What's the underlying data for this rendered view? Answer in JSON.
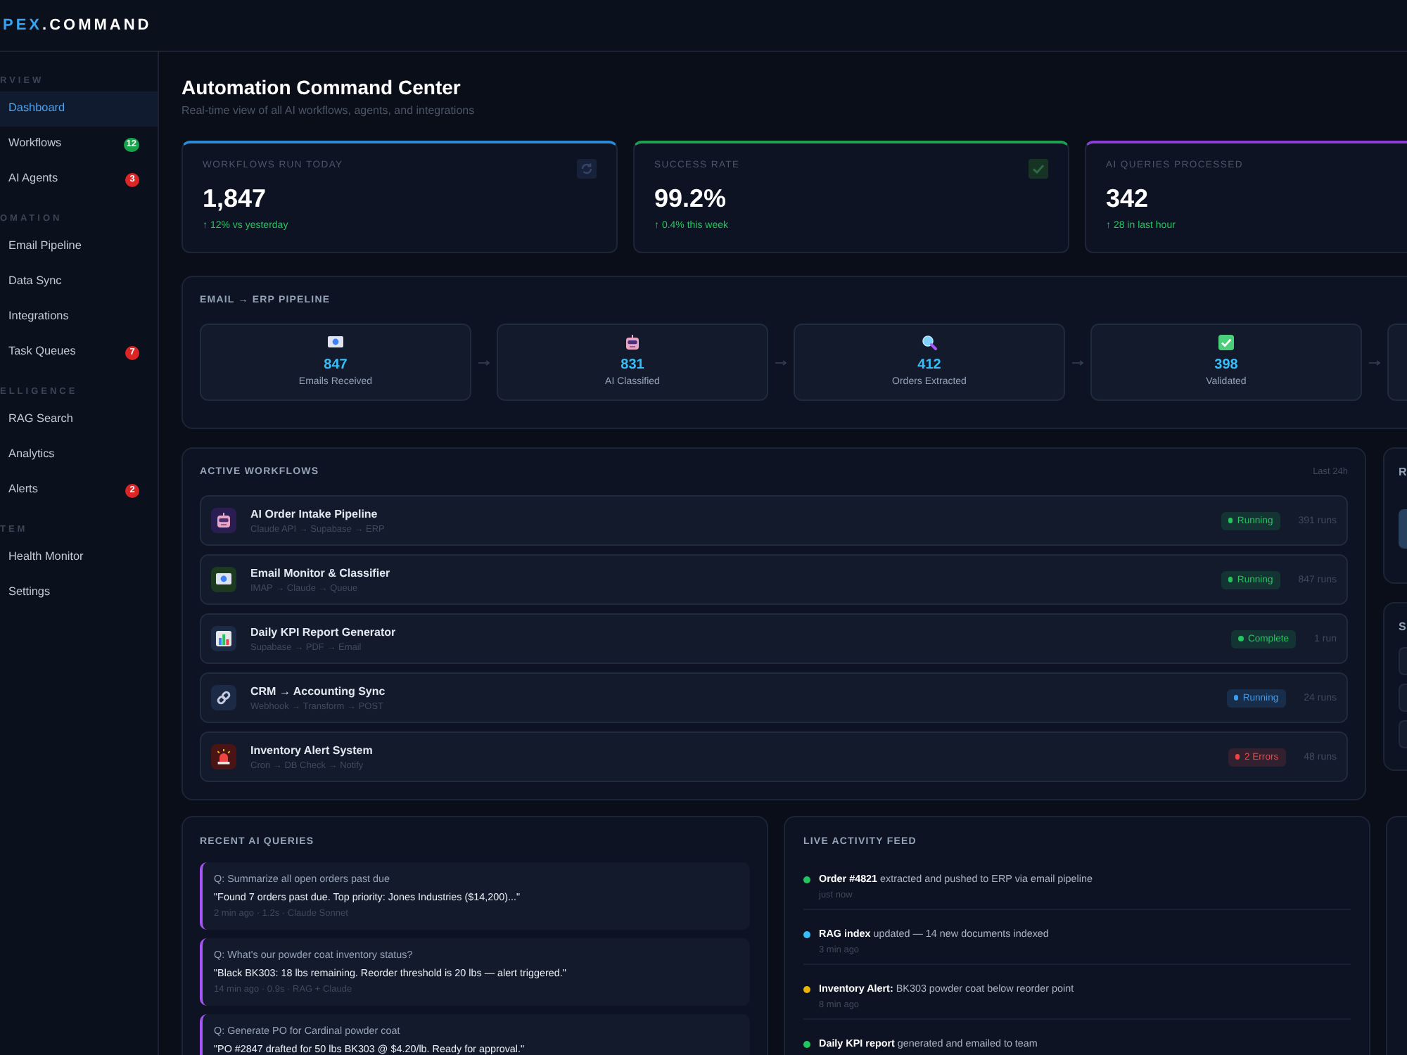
{
  "brand": {
    "accent": "PEX",
    "rest": ".COMMAND"
  },
  "sidebar": {
    "sections": [
      {
        "label": "RVIEW",
        "items": [
          {
            "label": "Dashboard",
            "selected": true
          },
          {
            "label": "Workflows",
            "selected": false,
            "badge": {
              "text": "12",
              "color": "#16a34a"
            }
          },
          {
            "label": "AI Agents",
            "selected": false,
            "badge": {
              "text": "3",
              "color": "#dc2626"
            }
          }
        ]
      },
      {
        "label": "OMATION",
        "items": [
          {
            "label": "Email Pipeline",
            "selected": false
          },
          {
            "label": "Data Sync",
            "selected": false
          },
          {
            "label": "Integrations",
            "selected": false
          },
          {
            "label": "Task Queues",
            "selected": false,
            "badge": {
              "text": "7",
              "color": "#dc2626"
            }
          }
        ]
      },
      {
        "label": "ELLIGENCE",
        "items": [
          {
            "label": "RAG Search",
            "selected": false
          },
          {
            "label": "Analytics",
            "selected": false
          },
          {
            "label": "Alerts",
            "selected": false,
            "badge": {
              "text": "2",
              "color": "#dc2626"
            }
          }
        ]
      },
      {
        "label": "TEM",
        "items": [
          {
            "label": "Health Monitor",
            "selected": false
          },
          {
            "label": "Settings",
            "selected": false
          }
        ]
      }
    ]
  },
  "header": {
    "title": "Automation Command Center",
    "subtitle": "Real-time view of all AI workflows, agents, and integrations"
  },
  "stats": [
    {
      "label": "WORKFLOWS RUN TODAY",
      "value": "1,847",
      "change": "↑ 12% vs yesterday",
      "color": "#2b8ad6"
    },
    {
      "label": "SUCCESS RATE",
      "value": "99.2%",
      "change": "↑ 0.4% this week",
      "color": "#1fa054"
    },
    {
      "label": "AI QUERIES PROCESSED",
      "value": "342",
      "change": "↑ 28 in last hour",
      "color": "#8b3fd6"
    }
  ],
  "pipeline": {
    "title": "EMAIL → ERP PIPELINE",
    "steps": [
      {
        "count": "847",
        "label": "Emails Received"
      },
      {
        "count": "831",
        "label": "AI Classified"
      },
      {
        "count": "412",
        "label": "Orders Extracted"
      },
      {
        "count": "398",
        "label": "Validated"
      }
    ]
  },
  "workflows": {
    "title": "ACTIVE WORKFLOWS",
    "period": "Last 24h",
    "items": [
      {
        "name": "AI Order Intake Pipeline",
        "route": "Claude API → Supabase → ERP",
        "status": {
          "text": "Running",
          "color": "#22c55e"
        },
        "runs": "391 runs"
      },
      {
        "name": "Email Monitor & Classifier",
        "route": "IMAP → Claude → Queue",
        "status": {
          "text": "Running",
          "color": "#22c55e"
        },
        "runs": "847 runs"
      },
      {
        "name": "Daily KPI Report Generator",
        "route": "Supabase → PDF → Email",
        "status": {
          "text": "Complete",
          "color": "#22c55e"
        },
        "runs": "1 run"
      },
      {
        "name": "CRM → Accounting Sync",
        "route": "Webhook → Transform → POST",
        "status": {
          "text": "Running",
          "color": "#3b9cf0"
        },
        "runs": "24 runs"
      },
      {
        "name": "Inventory Alert System",
        "route": "Cron → DB Check → Notify",
        "status": {
          "text": "2 Errors",
          "color": "#ef4444"
        },
        "runs": "48 runs"
      }
    ]
  },
  "side_panels": [
    {
      "title": "R"
    },
    {
      "title": "S"
    }
  ],
  "queries": {
    "title": "RECENT AI QUERIES",
    "items": [
      {
        "question": "Q: Summarize all open orders past due",
        "answer": "\"Found 7 orders past due. Top priority: Jones Industries ($14,200)...\"",
        "meta": "2 min ago · 1.2s · Claude Sonnet"
      },
      {
        "question": "Q: What's our powder coat inventory status?",
        "answer": "\"Black BK303: 18 lbs remaining. Reorder threshold is 20 lbs — alert triggered.\"",
        "meta": "14 min ago · 0.9s · RAG + Claude"
      },
      {
        "question": "Q: Generate PO for Cardinal powder coat",
        "answer": "\"PO #2847 drafted for 50 lbs BK303 @ $4.20/lb. Ready for approval.\""
      }
    ]
  },
  "activity": {
    "title": "LIVE ACTIVITY FEED",
    "items": [
      {
        "text": "**Order #4821** extracted and pushed to ERP via email pipeline",
        "time": "just now",
        "color": "#22c55e"
      },
      {
        "text": "**RAG index** updated — 14 new documents indexed",
        "time": "3 min ago",
        "color": "#38bdf8"
      },
      {
        "text": "**Inventory Alert:** BK303 powder coat below reorder point",
        "time": "8 min ago",
        "color": "#eab308"
      },
      {
        "text": "**Daily KPI report** generated and emailed to team",
        "color": "#22c55e"
      }
    ]
  }
}
